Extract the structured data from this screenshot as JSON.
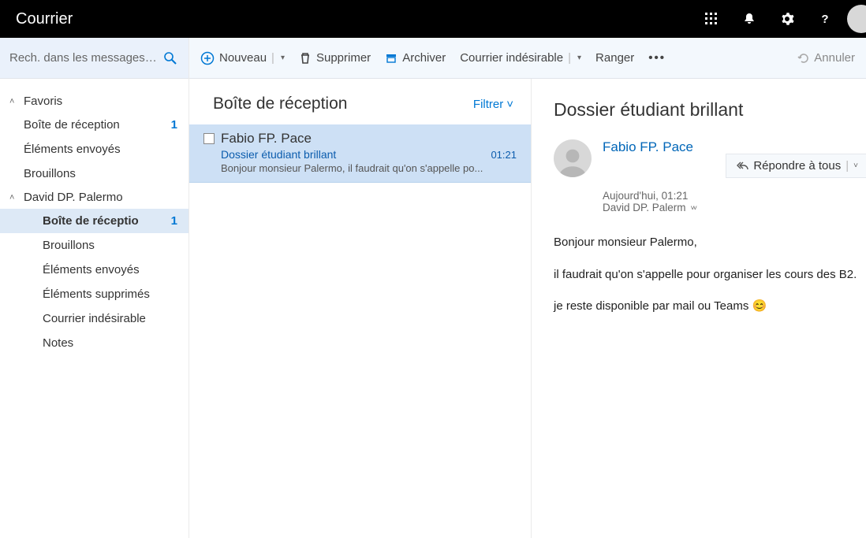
{
  "header": {
    "title": "Courrier"
  },
  "search": {
    "placeholder": "Rech. dans les messages e..."
  },
  "toolbar": {
    "new": "Nouveau",
    "delete": "Supprimer",
    "archive": "Archiver",
    "junk": "Courrier indésirable",
    "move": "Ranger",
    "undo": "Annuler"
  },
  "sidebar": {
    "fav_header": "Favoris",
    "fav": [
      {
        "label": "Boîte de réception",
        "badge": "1"
      },
      {
        "label": "Éléments envoyés"
      },
      {
        "label": "Brouillons"
      }
    ],
    "account_header": "David DP. Palermo",
    "folders": [
      {
        "label": "Boîte de réceptio",
        "badge": "1",
        "active": true
      },
      {
        "label": "Brouillons"
      },
      {
        "label": "Éléments envoyés"
      },
      {
        "label": "Éléments supprimés"
      },
      {
        "label": "Courrier indésirable"
      },
      {
        "label": "Notes"
      }
    ]
  },
  "list": {
    "title": "Boîte de réception",
    "filter": "Filtrer",
    "messages": [
      {
        "from": "Fabio FP. Pace",
        "subject": "Dossier étudiant brillant",
        "time": "01:21",
        "preview": "Bonjour monsieur Palermo, il faudrait qu'on s'appelle po..."
      }
    ]
  },
  "reading": {
    "subject": "Dossier étudiant brillant",
    "from": "Fabio FP. Pace",
    "reply_all": "Répondre à tous",
    "timestamp": "Aujourd'hui, 01:21",
    "to": "David DP. Palerm",
    "body": [
      "Bonjour monsieur Palermo,",
      "il faudrait qu'on s'appelle pour organiser les cours des B2.",
      "je reste disponible par mail ou Teams 😊"
    ]
  }
}
